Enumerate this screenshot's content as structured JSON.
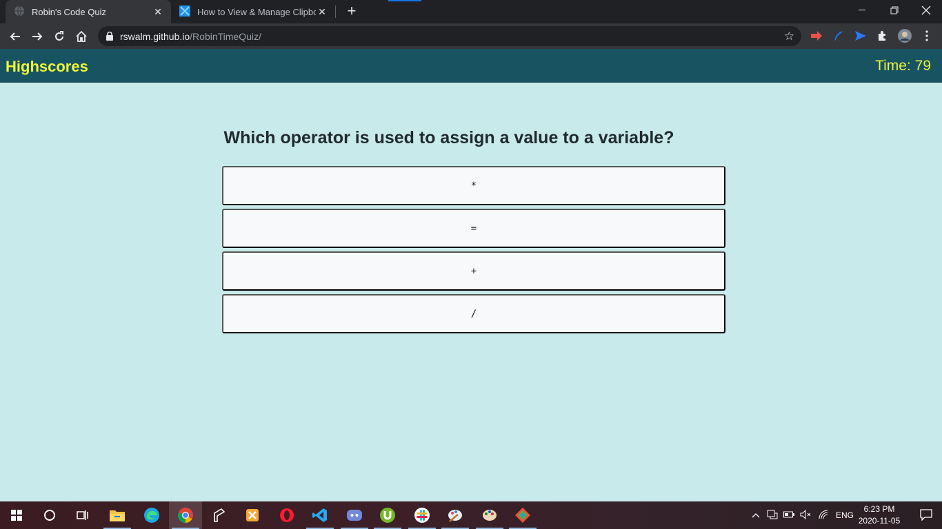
{
  "browser": {
    "tabs": [
      {
        "title": "Robin's Code Quiz",
        "active": true
      },
      {
        "title": "How to View & Manage Clipboar",
        "active": false
      }
    ],
    "url_host": "rswalm.github.io",
    "url_path": "/RobinTimeQuiz/"
  },
  "header": {
    "highscores_label": "Highscores",
    "timer_text": "Time: 79"
  },
  "quiz": {
    "question": "Which operator is used to assign a value to a variable?",
    "answers": [
      "*",
      "=",
      "+",
      "/"
    ]
  },
  "taskbar": {
    "language": "ENG",
    "time": "6:23 PM",
    "date": "2020-11-05"
  },
  "colors": {
    "page_bg": "#c9eaea",
    "header_bg": "#175361",
    "header_text": "#eef53b",
    "answer_bg": "#f7f9fa"
  }
}
